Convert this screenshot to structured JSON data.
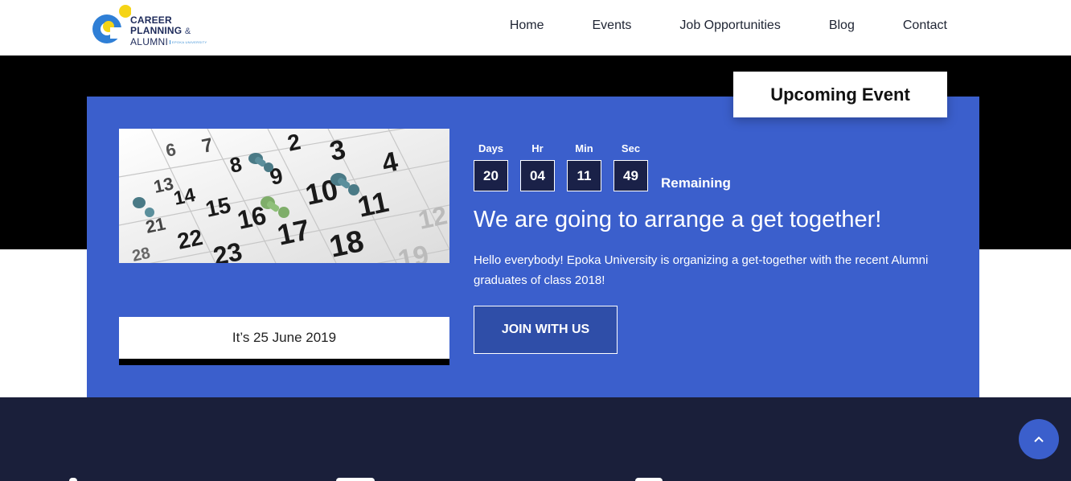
{
  "logo": {
    "line1": "CAREER",
    "line2": "PLANNING",
    "amp": "&",
    "line3": "ALUMNI",
    "university": "EPOKA UNIVERSITY"
  },
  "nav": [
    {
      "label": "Home"
    },
    {
      "label": "Events"
    },
    {
      "label": "Job Opportunities"
    },
    {
      "label": "Blog"
    },
    {
      "label": "Contact"
    }
  ],
  "event": {
    "tag": "Upcoming Event",
    "date_text": "It’s 25 June 2019",
    "countdown": [
      {
        "label": "Days",
        "value": "20"
      },
      {
        "label": "Hr",
        "value": "04"
      },
      {
        "label": "Min",
        "value": "11"
      },
      {
        "label": "Sec",
        "value": "49"
      }
    ],
    "remaining": "Remaining",
    "headline": "We are going to arrange a get together!",
    "description": "Hello everybody! Epoka University is organizing a get-together with the recent Alumni graduates of class 2018!",
    "button": "JOIN WITH US"
  },
  "colors": {
    "brand_blue": "#3b5fcc",
    "dark_navy": "#1a1f3a",
    "countdown_box": "#1a2148",
    "logo_yellow": "#f5d416",
    "logo_blue": "#2f7fd6"
  },
  "icons": {
    "scroll_top": "chevron-up-icon"
  }
}
